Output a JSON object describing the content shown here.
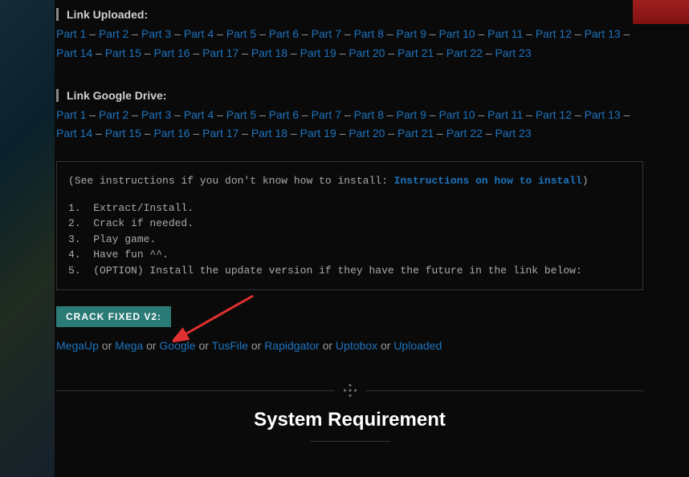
{
  "bg": {},
  "sections": {
    "uploaded": {
      "title": "Link Uploaded:",
      "parts": [
        "Part 1",
        "Part 2",
        "Part 3",
        "Part 4",
        "Part 5",
        "Part 6",
        "Part 7",
        "Part 8",
        "Part 9",
        "Part 10",
        "Part 11",
        "Part 12",
        "Part 13",
        "Part 14",
        "Part 15",
        "Part 16",
        "Part 17",
        "Part 18",
        "Part 19",
        "Part 20",
        "Part 21",
        "Part 22",
        "Part 23"
      ]
    },
    "gdrive": {
      "title": "Link Google Drive:",
      "parts": [
        "Part 1",
        "Part 2",
        "Part 3",
        "Part 4",
        "Part 5",
        "Part 6",
        "Part 7",
        "Part 8",
        "Part 9",
        "Part 10",
        "Part 11",
        "Part 12",
        "Part 13",
        "Part 14",
        "Part 15",
        "Part 16",
        "Part 17",
        "Part 18",
        "Part 19",
        "Part 20",
        "Part 21",
        "Part 22",
        "Part 23"
      ]
    }
  },
  "instructions": {
    "intro_prefix": "(See instructions if you don't know how to install: ",
    "intro_link": "Instructions on how to install",
    "intro_suffix": ")",
    "steps": [
      "Extract/Install.",
      "Crack if needed.",
      "Play game.",
      "Have fun ^^.",
      "(OPTION) Install the update version if they have the future in the link below:"
    ]
  },
  "crack": {
    "tag": "CRACK FIXED V2:",
    "links": [
      "MegaUp",
      "Mega",
      "Google",
      "TusFile",
      "Rapidgator",
      "Uptobox",
      "Uploaded"
    ],
    "or": " or "
  },
  "requirement": {
    "title": "System Requirement"
  },
  "sep": " – "
}
